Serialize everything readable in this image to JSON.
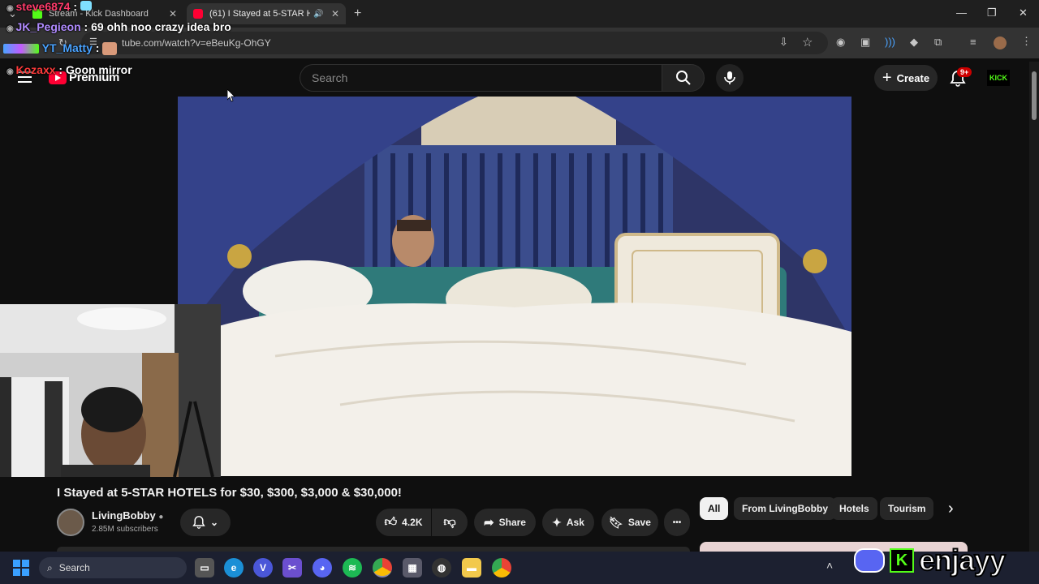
{
  "browser": {
    "tabs": [
      {
        "label": "Stream - Kick Dashboard",
        "close": "✕"
      },
      {
        "label": "(61) I Stayed at 5-STAR HOT",
        "close": "✕"
      }
    ],
    "new_tab": "+",
    "url": "tube.com/watch?v=eBeuKg-OhGY",
    "window_controls": {
      "minimize": "—",
      "restore": "❐",
      "close": "✕"
    }
  },
  "youtube": {
    "logo_text": "Premium",
    "search_placeholder": "Search",
    "create_label": "Create",
    "notifications_badge": "9+",
    "kick_label": "KICK"
  },
  "video": {
    "title": "I Stayed at 5-STAR HOTELS for $30, $300, $3,000 & $30,000!",
    "channel": "LivingBobby",
    "subscribers": "2.85M subscribers",
    "likes": "4.2K",
    "share_label": "Share",
    "ask_label": "Ask",
    "save_label": "Save",
    "more_label": "•••"
  },
  "chips": [
    "All",
    "From LivingBobby",
    "Hotels",
    "Tourism"
  ],
  "chat": [
    {
      "user": "steve6874",
      "sep": " : ",
      "message": "",
      "color": "#ff3b6b"
    },
    {
      "user": "JK_Pegieon",
      "sep": " : ",
      "message": "69 ohh noo crazy idea bro",
      "color": "#b08bff"
    },
    {
      "user": "YT_Matty",
      "sep": " : ",
      "message": "",
      "color": "#4aa3ff"
    },
    {
      "user": "Kozaxx",
      "sep": " : ",
      "message": "Goon mirror",
      "color": "#ff3b3b"
    }
  ],
  "taskbar": {
    "search_label": "Search",
    "watermark": "enjayy"
  },
  "colors": {
    "accent_red": "#ff0033",
    "kick_green": "#53fc18",
    "page_bg": "#0f0f0f"
  }
}
